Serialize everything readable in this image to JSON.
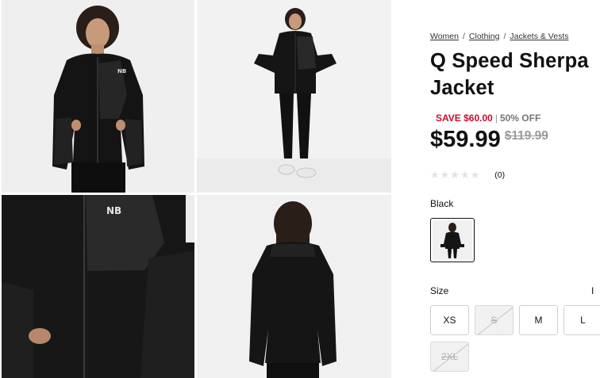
{
  "breadcrumb": [
    "Women",
    "Clothing",
    "Jackets & Vests"
  ],
  "product": {
    "title": "Q Speed Sherpa Jacket",
    "save_text": "SAVE $60.00",
    "separator": "|",
    "off_text": "50% OFF",
    "price": "$59.99",
    "original_price": "$119.99",
    "rating_stars": "★★★★★",
    "rating_count": "(0)",
    "color_label": "Black",
    "size_label": "Size",
    "size_guide_partial": "I"
  },
  "sizes": [
    {
      "label": "XS",
      "available": true
    },
    {
      "label": "S",
      "available": false
    },
    {
      "label": "M",
      "available": true
    },
    {
      "label": "L",
      "available": true
    },
    {
      "label": "2XL",
      "available": false
    }
  ],
  "colors": {
    "accent_red": "#cf0a2c",
    "price_gray": "#9a9a9a",
    "jacket": "#141414"
  },
  "icons": [
    "star-icon",
    "new-balance-logo"
  ]
}
